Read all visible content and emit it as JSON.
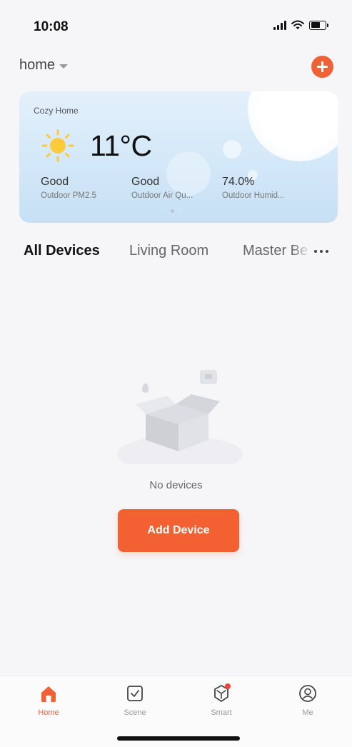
{
  "status_bar": {
    "time": "10:08"
  },
  "header": {
    "home_label": "home"
  },
  "weather": {
    "location": "Cozy Home",
    "temperature": "11°C",
    "stats": [
      {
        "value": "Good",
        "label": "Outdoor PM2.5"
      },
      {
        "value": "Good",
        "label": "Outdoor Air Qu..."
      },
      {
        "value": "74.0%",
        "label": "Outdoor Humid..."
      }
    ]
  },
  "room_tabs": [
    "All Devices",
    "Living Room",
    "Master Be"
  ],
  "empty_state": {
    "message": "No devices",
    "button_label": "Add Device"
  },
  "bottom_nav": [
    {
      "label": "Home",
      "icon": "home-icon"
    },
    {
      "label": "Scene",
      "icon": "scene-icon"
    },
    {
      "label": "Smart",
      "icon": "smart-icon"
    },
    {
      "label": "Me",
      "icon": "profile-icon"
    }
  ],
  "colors": {
    "accent": "#f06236",
    "card_background": "#d3e8f8"
  }
}
